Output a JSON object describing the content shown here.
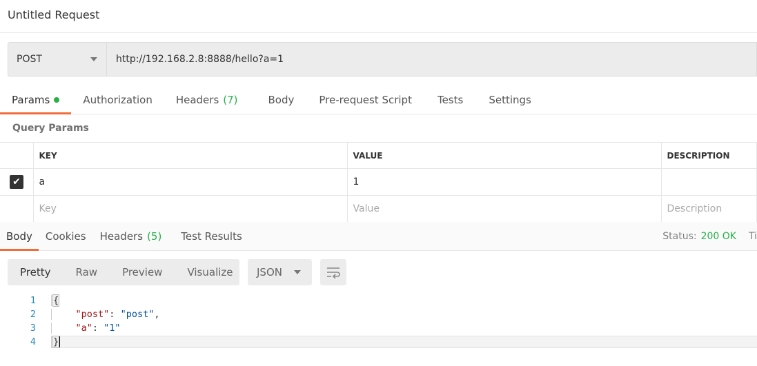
{
  "title": "Untitled Request",
  "request": {
    "method": "POST",
    "url": "http://192.168.2.8:8888/hello?a=1"
  },
  "req_tabs": [
    {
      "label": "Params"
    },
    {
      "label": "Authorization"
    },
    {
      "label": "Headers",
      "count": "(7)"
    },
    {
      "label": "Body"
    },
    {
      "label": "Pre-request Script"
    },
    {
      "label": "Tests"
    },
    {
      "label": "Settings"
    }
  ],
  "query_params": {
    "title": "Query Params",
    "headers": [
      "KEY",
      "VALUE",
      "DESCRIPTION"
    ],
    "rows": [
      {
        "checked": true,
        "key": "a",
        "value": "1",
        "description": ""
      }
    ],
    "placeholders": {
      "key": "Key",
      "value": "Value",
      "description": "Description"
    }
  },
  "resp_tabs": [
    {
      "label": "Body"
    },
    {
      "label": "Cookies"
    },
    {
      "label": "Headers",
      "count": "(5)"
    },
    {
      "label": "Test Results"
    }
  ],
  "status": {
    "label": "Status:",
    "value": "200 OK",
    "next": "Ti"
  },
  "view_modes": [
    "Pretty",
    "Raw",
    "Preview",
    "Visualize"
  ],
  "format": "JSON",
  "code": {
    "lines": [
      "1",
      "2",
      "3",
      "4"
    ],
    "open": "{",
    "k1": "\"post\"",
    "v1": "\"post\"",
    "k2": "\"a\"",
    "v2": "\"1\"",
    "close": "}"
  },
  "colors": {
    "accent": "#f26b3a",
    "success": "#26b047"
  }
}
